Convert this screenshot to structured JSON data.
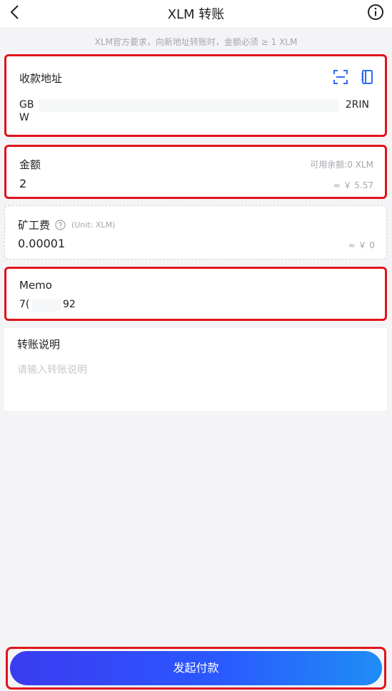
{
  "header": {
    "title": "XLM 转账",
    "back_icon": "chevron-left-icon",
    "info_icon": "info-circle-icon"
  },
  "notice": "XLM官方要求，向新地址转账时，金额必须 ≥ 1 XLM",
  "address": {
    "label": "收款地址",
    "line1_start": "GB",
    "line1_end": "2RIN",
    "line2_start": "W",
    "scan_icon": "scan-icon",
    "address_book_icon": "address-book-icon"
  },
  "amount": {
    "label": "金额",
    "balance_note": "可用余额:0 XLM",
    "value": "2",
    "fiat": "≈ ￥ 5.57"
  },
  "fee": {
    "label": "矿工费",
    "unit": "(Unit: XLM)",
    "value": "0.00001",
    "fiat": "≈ ￥ 0"
  },
  "memo": {
    "label": "Memo",
    "value_start": "7(",
    "value_end": "92"
  },
  "description": {
    "label": "转账说明",
    "placeholder": "请输入转账说明"
  },
  "submit": {
    "label": "发起付款"
  },
  "colors": {
    "highlight_border": "#e0141b",
    "button_gradient_start": "#3b3bf0",
    "button_gradient_end": "#1f8df6",
    "icon_blue": "#2f6cf6"
  }
}
